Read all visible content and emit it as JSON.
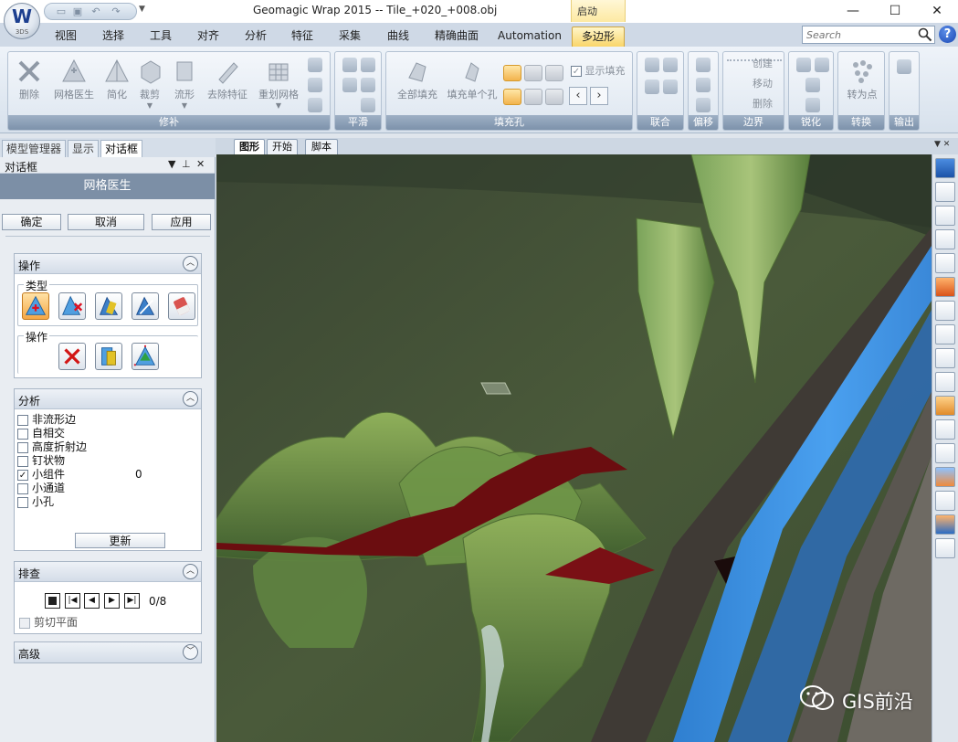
{
  "app": {
    "logo_letter": "W",
    "logo_sub": "3DS",
    "title": "Geomagic Wrap 2015 -- Tile_+020_+008.obj",
    "context_tab_group": "启动"
  },
  "window_controls": {
    "minimize": "—",
    "maximize": "☐",
    "close": "✕"
  },
  "ribbon_tabs": [
    "视图",
    "选择",
    "工具",
    "对齐",
    "分析",
    "特征",
    "采集",
    "曲线",
    "精确曲面",
    "Automation",
    "多边形"
  ],
  "active_tab": "多边形",
  "search": {
    "placeholder": "Search"
  },
  "ribbon": {
    "repair": {
      "label": "修补",
      "buttons": [
        "删除",
        "网格医生",
        "简化",
        "裁剪",
        "流形",
        "去除特征",
        "重划网格"
      ]
    },
    "smooth": {
      "label": "平滑"
    },
    "fill_holes": {
      "label": "填充孔",
      "buttons": [
        "全部填充",
        "填充单个孔"
      ],
      "show_fill_label": "显示填充",
      "show_fill_checked": true
    },
    "combine": {
      "label": "联合"
    },
    "offset": {
      "label": "偏移"
    },
    "boundary": {
      "label": "边界",
      "items": [
        "创建",
        "移动",
        "删除"
      ]
    },
    "sharpen": {
      "label": "锐化"
    },
    "convert": {
      "label": "转换",
      "buttons": [
        "转为点"
      ]
    },
    "output": {
      "label": "输出"
    }
  },
  "panel_tabs": [
    "模型管理器",
    "显示",
    "对话框"
  ],
  "active_panel_tab": "对话框",
  "dialog": {
    "header": "对话框",
    "title": "网格医生",
    "ok": "确定",
    "cancel": "取消",
    "apply": "应用",
    "operation_section": {
      "title": "操作",
      "type_label": "类型",
      "ops_label": "操作"
    },
    "analysis_section": {
      "title": "分析",
      "items": [
        {
          "label": "非流形边",
          "checked": false,
          "count": ""
        },
        {
          "label": "自相交",
          "checked": false,
          "count": ""
        },
        {
          "label": "高度折射边",
          "checked": false,
          "count": ""
        },
        {
          "label": "钉状物",
          "checked": false,
          "count": ""
        },
        {
          "label": "小组件",
          "checked": true,
          "count": "0"
        },
        {
          "label": "小通道",
          "checked": false,
          "count": ""
        },
        {
          "label": "小孔",
          "checked": false,
          "count": ""
        }
      ],
      "update": "更新"
    },
    "review_section": {
      "title": "排查",
      "counter": "0/8",
      "clip_plane": "剪切平面"
    },
    "advanced_section": {
      "title": "高级"
    }
  },
  "view_tabs": [
    "图形",
    "开始",
    "脚本"
  ],
  "active_view_tab": "图形",
  "watermark": "GIS前沿",
  "colors": {
    "ribbon_group_label": "#7d92ab",
    "active_tab": "#f9d56a",
    "panel_title": "#7c8fa6",
    "terrain": "#4f6b3a",
    "water": "#3f8fd8",
    "defect": "#6b0d10"
  }
}
